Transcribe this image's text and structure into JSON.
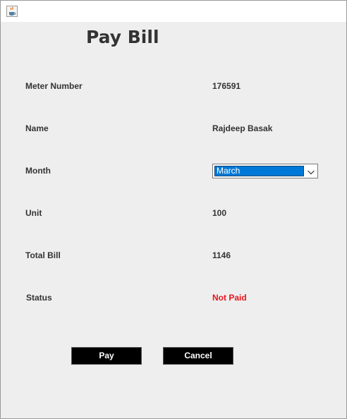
{
  "window": {
    "icon": "java-cup-icon"
  },
  "heading": "Pay Bill",
  "fields": {
    "meter_number": {
      "label": "Meter Number",
      "value": "176591"
    },
    "name": {
      "label": "Name",
      "value": "Rajdeep Basak"
    },
    "month": {
      "label": "Month",
      "selected": "March"
    },
    "unit": {
      "label": "Unit",
      "value": "100"
    },
    "total_bill": {
      "label": "Total Bill",
      "value": "1146"
    },
    "status": {
      "label": "Status",
      "value": "Not Paid",
      "color": "#e8131b"
    }
  },
  "buttons": {
    "pay": "Pay",
    "cancel": "Cancel"
  },
  "colors": {
    "button_bg": "#000000",
    "selection": "#0078d7"
  }
}
